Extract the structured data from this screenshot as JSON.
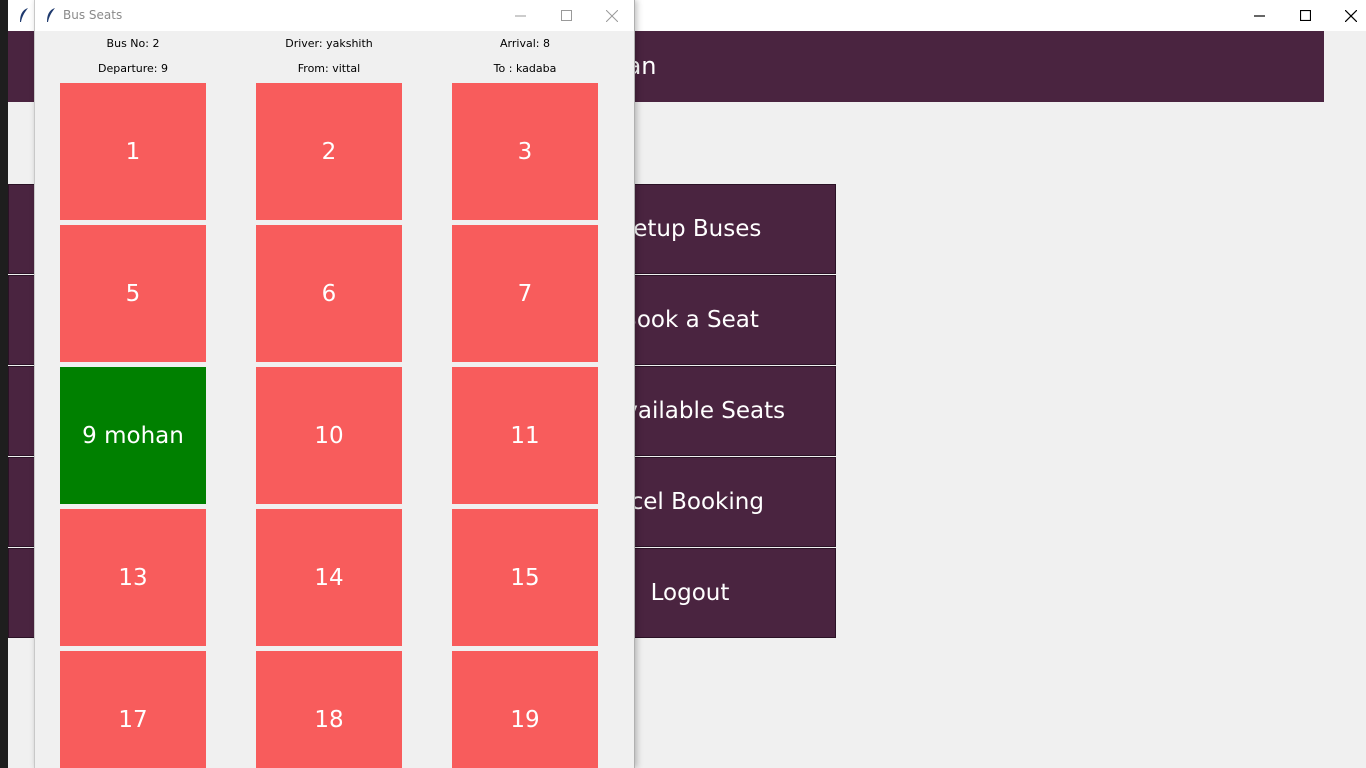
{
  "main_window": {
    "welcome_text": "lcome mohan",
    "menu": [
      {
        "label": "Setup Buses"
      },
      {
        "label": "Book a Seat"
      },
      {
        "label": "/ Available Seats"
      },
      {
        "label": "ncel Booking"
      },
      {
        "label": "Logout"
      }
    ]
  },
  "seats_window": {
    "title": "Bus Seats",
    "info": {
      "bus_no": "Bus No: 2",
      "driver": "Driver: yakshith",
      "arrival": "Arrival: 8",
      "departure": "Departure: 9",
      "from": "From: vittal",
      "to": "To : kadaba"
    },
    "seats": [
      {
        "label": "1",
        "status": "available"
      },
      {
        "label": "2",
        "status": "available"
      },
      {
        "label": "3",
        "status": "available"
      },
      {
        "label": "5",
        "status": "available"
      },
      {
        "label": "6",
        "status": "available"
      },
      {
        "label": "7",
        "status": "available"
      },
      {
        "label": "9 mohan",
        "status": "booked"
      },
      {
        "label": "10",
        "status": "available"
      },
      {
        "label": "11",
        "status": "available"
      },
      {
        "label": "13",
        "status": "available"
      },
      {
        "label": "14",
        "status": "available"
      },
      {
        "label": "15",
        "status": "available"
      },
      {
        "label": "17",
        "status": "available"
      },
      {
        "label": "18",
        "status": "available"
      },
      {
        "label": "19",
        "status": "available"
      }
    ]
  },
  "colors": {
    "available": "#f85c5c",
    "booked": "#008000",
    "accent": "#4a2440"
  }
}
